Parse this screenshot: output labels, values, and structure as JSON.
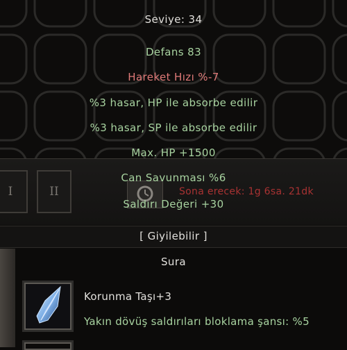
{
  "tooltip": {
    "level": "Seviye: 34",
    "defense": "Defans 83",
    "move_speed": "Hareket Hızı %-7",
    "hp_absorb": "%3 hasar, HP ile absorbe edilir",
    "sp_absorb": "%3 hasar, SP ile absorbe edilir",
    "max_hp": "Max. HP +1500",
    "life_defense": "Can Savunması %6",
    "attack_value": "Saldırı Değeri +30",
    "wearable": "[ Giyilebilir ]",
    "class": "Sura"
  },
  "slots": {
    "left_label": "I",
    "right_label": "II"
  },
  "expiry": {
    "text": "Sona erecek: 1g 6sa. 21dk"
  },
  "socket": {
    "name": "Korunma Taşı+3",
    "bonus": "Yakın dövüş saldırıları bloklama şansı: %5"
  },
  "colors": {
    "white": "#e2e0dc",
    "green": "#a8d3a0",
    "red": "#e07a78",
    "expire_red": "#a83232"
  }
}
